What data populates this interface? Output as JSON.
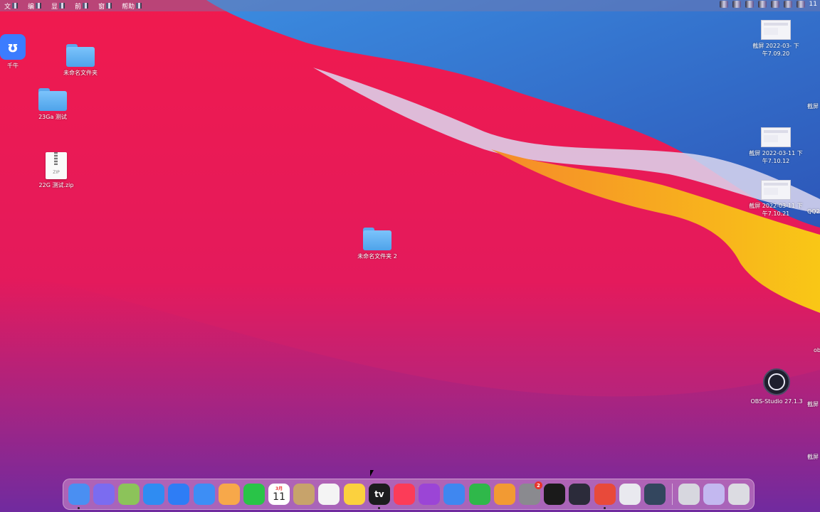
{
  "menubar": {
    "items": [
      {
        "label": "文"
      },
      {
        "label": "编"
      },
      {
        "label": "显"
      },
      {
        "label": "前"
      },
      {
        "label": "窗"
      },
      {
        "label": "帮助"
      }
    ],
    "clock": "11"
  },
  "desktop": {
    "left_icons": [
      {
        "label": "千牛",
        "icon": "qianniu-icon"
      },
      {
        "label": "未命名文件夹",
        "icon": "folder-icon"
      },
      {
        "label": "23Ga 测试",
        "icon": "folder-icon"
      },
      {
        "label": "22G 测试.zip",
        "icon": "zip-archive-icon",
        "zip_text": "ZIP"
      }
    ],
    "center_icons": [
      {
        "label": "未命名文件夹 2",
        "icon": "folder-icon"
      }
    ],
    "right_icons": [
      {
        "label": "截屏 2022-03- 下\n午7.09.20",
        "icon": "screenshot-icon"
      },
      {
        "label": "截屏 2022-03-11 下\n午7.10.12",
        "icon": "screenshot-icon"
      },
      {
        "label": "截屏 2022-03-11 下\n午7.10.21",
        "icon": "screenshot-icon"
      },
      {
        "label": "OBS-Studio 27.1.3",
        "icon": "obs-icon"
      }
    ],
    "edge_labels": [
      "截屏",
      "QQ2",
      "ob",
      "截屏",
      "截屏"
    ]
  },
  "dock": {
    "apps": [
      {
        "name": "finder",
        "icon": "finder-icon",
        "color": "#4a8ff2",
        "running": true
      },
      {
        "name": "launchpad",
        "icon": "launchpad-icon",
        "color": "#7b6cf0",
        "running": false
      },
      {
        "name": "app-glitched",
        "icon": "app-icon",
        "color": "#8cc35a",
        "running": false
      },
      {
        "name": "safari",
        "icon": "safari-icon",
        "color": "#2f8cf2",
        "running": false
      },
      {
        "name": "app-store",
        "icon": "app-store-icon",
        "color": "#2e7df5",
        "running": false
      },
      {
        "name": "mail",
        "icon": "mail-icon",
        "color": "#3d8ef5",
        "running": false
      },
      {
        "name": "photos",
        "icon": "photos-icon",
        "color": "#f7a84a",
        "running": false
      },
      {
        "name": "facetime",
        "icon": "facetime-icon",
        "color": "#29c448",
        "running": false
      },
      {
        "name": "calendar",
        "icon": "calendar-icon",
        "color": "#ffffff",
        "running": false,
        "month": "3月",
        "day": "11"
      },
      {
        "name": "contacts",
        "icon": "contacts-icon",
        "color": "#c7a36b",
        "running": false
      },
      {
        "name": "reminders",
        "icon": "reminders-icon",
        "color": "#f4f4f4",
        "running": false
      },
      {
        "name": "notes",
        "icon": "notes-icon",
        "color": "#fbd13e",
        "running": false
      },
      {
        "name": "apple-tv",
        "icon": "apple-tv-icon",
        "color": "#1c1c1e",
        "running": true,
        "text": "tv"
      },
      {
        "name": "music",
        "icon": "music-icon",
        "color": "#fc3c58",
        "running": false
      },
      {
        "name": "podcasts",
        "icon": "podcasts-icon",
        "color": "#9b45d6",
        "running": false
      },
      {
        "name": "keynote",
        "icon": "keynote-icon",
        "color": "#3f87f0",
        "running": false
      },
      {
        "name": "numbers",
        "icon": "numbers-icon",
        "color": "#2fb84a",
        "running": false
      },
      {
        "name": "pages",
        "icon": "pages-icon",
        "color": "#f29a33",
        "running": false
      },
      {
        "name": "system-preferences",
        "icon": "system-preferences-icon",
        "color": "#8a8a8f",
        "running": false,
        "badge": "2"
      },
      {
        "name": "qq",
        "icon": "qq-penguin-icon",
        "color": "#1a1a1a",
        "running": false
      },
      {
        "name": "app-dark-round",
        "icon": "app-icon",
        "color": "#2b2b3a",
        "running": false
      },
      {
        "name": "app-red",
        "icon": "app-icon",
        "color": "#e84a3a",
        "running": true
      },
      {
        "name": "preview",
        "icon": "preview-icon",
        "color": "#e9e9ef",
        "running": false
      },
      {
        "name": "quicktime",
        "icon": "quicktime-icon",
        "color": "#33465e",
        "running": false
      }
    ],
    "right_items": [
      {
        "name": "screenshot-stack",
        "icon": "screenshot-stack-icon",
        "color": "#d7d7df"
      },
      {
        "name": "downloads-stack",
        "icon": "downloads-stack-icon",
        "color": "#c3b8f0"
      },
      {
        "name": "trash",
        "icon": "trash-icon",
        "color": "#dcdce2"
      }
    ]
  },
  "colors": {
    "wallpaper_red": "#f0234f",
    "wallpaper_blue": "#3f7fd8",
    "wallpaper_yellow": "#f7b11b",
    "wallpaper_purple": "#7a2c9c"
  }
}
